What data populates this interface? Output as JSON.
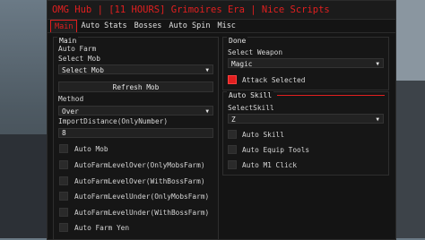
{
  "title": "OMG Hub | [11 HOURS] Grimoires Era | Nice Scripts",
  "tabs": [
    "Main",
    "Auto Stats",
    "Bosses",
    "Auto Spin",
    "Misc"
  ],
  "main": {
    "title": "Main",
    "auto_farm_label": "Auto Farm",
    "select_mob_label": "Select Mob",
    "select_mob_value": "Select Mob",
    "refresh_button": "Refresh Mob",
    "method_label": "Method",
    "method_value": "Over",
    "import_distance_label": "ImportDistance(OnlyNumber)",
    "import_distance_value": "8",
    "toggles": [
      {
        "label": "Auto Mob",
        "checked": false
      },
      {
        "label": "AutoFarmLevelOver(OnlyMobsFarm)",
        "checked": false
      },
      {
        "label": "AutoFarmLevelOver(WithBossFarm)",
        "checked": false
      },
      {
        "label": "AutoFarmLevelUnder(OnlyMobsFarm)",
        "checked": false
      },
      {
        "label": "AutoFarmLevelUnder(WithBossFarm)",
        "checked": false
      },
      {
        "label": "Auto Farm Yen",
        "checked": false
      }
    ]
  },
  "done": {
    "title": "Done",
    "select_weapon_label": "Select Weapon",
    "select_weapon_value": "Magic",
    "attack_selected_label": "Attack Selected",
    "attack_selected_checked": true
  },
  "auto_skill": {
    "title": "Auto Skill",
    "select_skill_label": "SelectSkill",
    "select_skill_value": "Z",
    "toggles": [
      {
        "label": "Auto Skill",
        "checked": false
      },
      {
        "label": "Auto Equip Tools",
        "checked": false
      },
      {
        "label": "Auto M1 Click",
        "checked": false
      }
    ]
  },
  "colors": {
    "accent": "#e11f1f",
    "window_bg": "#141414",
    "control_bg": "#222222"
  }
}
